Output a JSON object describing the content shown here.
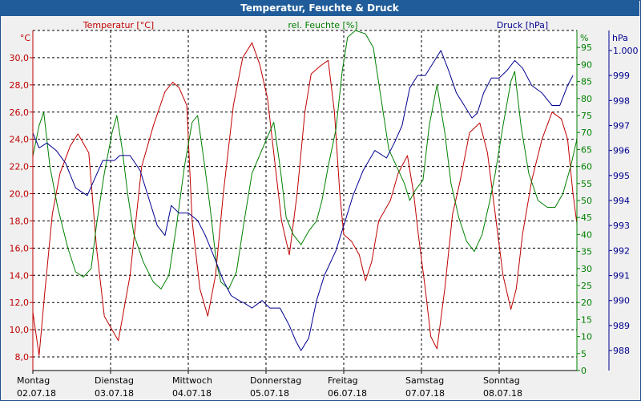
{
  "window": {
    "title": "Temperatur, Feuchte & Druck"
  },
  "chart_data": {
    "type": "line",
    "title": "Temperatur, Feuchte & Druck",
    "grid": true,
    "x_axis": {
      "range": [
        0,
        7
      ],
      "labels": [
        {
          "x": 0,
          "day": "Montag",
          "date": "02.07.18"
        },
        {
          "x": 1,
          "day": "Dienstag",
          "date": "03.07.18"
        },
        {
          "x": 2,
          "day": "Mittwoch",
          "date": "04.07.18"
        },
        {
          "x": 3,
          "day": "Donnerstag",
          "date": "05.07.18"
        },
        {
          "x": 4,
          "day": "Freitag",
          "date": "06.07.18"
        },
        {
          "x": 5,
          "day": "Samstag",
          "date": "07.07.18"
        },
        {
          "x": 6,
          "day": "Sonntag",
          "date": "08.07.18"
        }
      ]
    },
    "axes": {
      "temperature": {
        "label": "Temperatur [°C]",
        "unit": "°C",
        "color": "#c00000",
        "range": [
          7,
          32
        ],
        "ticks": [
          "8,0",
          "10,0",
          "12,0",
          "14,0",
          "16,0",
          "18,0",
          "20,0",
          "22,0",
          "24,0",
          "26,0",
          "28,0",
          "30,0"
        ],
        "tick_values": [
          8,
          10,
          12,
          14,
          16,
          18,
          20,
          22,
          24,
          26,
          28,
          30
        ]
      },
      "humidity": {
        "label": "rel. Feuchte [%]",
        "unit": "%",
        "color": "#008000",
        "range": [
          0,
          100
        ],
        "ticks": [
          "0",
          "5",
          "10",
          "15",
          "20",
          "25",
          "30",
          "35",
          "40",
          "45",
          "50",
          "55",
          "60",
          "65",
          "70",
          "75",
          "80",
          "85",
          "90",
          "95"
        ],
        "tick_values": [
          0,
          5,
          10,
          15,
          20,
          25,
          30,
          35,
          40,
          45,
          50,
          55,
          60,
          65,
          70,
          75,
          80,
          85,
          90,
          95
        ]
      },
      "pressure": {
        "label": "Druck [hPa]",
        "unit": "hPa",
        "color": "#000090",
        "range": [
          987.2,
          1000.8
        ],
        "ticks": [
          "988",
          "989",
          "990",
          "991",
          "992",
          "993",
          "994",
          "995",
          "996",
          "997",
          "998",
          "999",
          "1.000"
        ],
        "tick_values": [
          988,
          989,
          990,
          991,
          992,
          993,
          994,
          995,
          996,
          997,
          998,
          999,
          1000
        ]
      }
    },
    "series": [
      {
        "name": "Temperatur [°C]",
        "axis": "temperature",
        "color": "#c00000",
        "points": [
          [
            0,
            11.3
          ],
          [
            0.08,
            8.1
          ],
          [
            0.15,
            12.5
          ],
          [
            0.25,
            18.5
          ],
          [
            0.35,
            21.5
          ],
          [
            0.48,
            23.5
          ],
          [
            0.58,
            24.4
          ],
          [
            0.72,
            23.0
          ],
          [
            0.82,
            16.0
          ],
          [
            0.92,
            11.0
          ],
          [
            1.1,
            9.2
          ],
          [
            1.25,
            14.0
          ],
          [
            1.4,
            22.0
          ],
          [
            1.55,
            25.0
          ],
          [
            1.7,
            27.5
          ],
          [
            1.8,
            28.2
          ],
          [
            1.88,
            27.8
          ],
          [
            1.98,
            26.5
          ],
          [
            2.05,
            18.0
          ],
          [
            2.15,
            13.0
          ],
          [
            2.25,
            11.0
          ],
          [
            2.35,
            14.0
          ],
          [
            2.45,
            20.0
          ],
          [
            2.58,
            26.5
          ],
          [
            2.7,
            30.0
          ],
          [
            2.82,
            31.1
          ],
          [
            2.92,
            29.5
          ],
          [
            3.02,
            27.0
          ],
          [
            3.12,
            22.0
          ],
          [
            3.2,
            18.0
          ],
          [
            3.3,
            15.5
          ],
          [
            3.4,
            20.0
          ],
          [
            3.5,
            26.0
          ],
          [
            3.58,
            28.8
          ],
          [
            3.7,
            29.4
          ],
          [
            3.8,
            29.8
          ],
          [
            3.88,
            26.0
          ],
          [
            3.95,
            20.0
          ],
          [
            4.0,
            17.0
          ],
          [
            4.1,
            16.5
          ],
          [
            4.2,
            15.5
          ],
          [
            4.28,
            13.6
          ],
          [
            4.36,
            15.0
          ],
          [
            4.45,
            18.0
          ],
          [
            4.6,
            19.5
          ],
          [
            4.7,
            21.5
          ],
          [
            4.82,
            22.8
          ],
          [
            4.9,
            20.0
          ],
          [
            4.96,
            17.0
          ],
          [
            5.05,
            13.0
          ],
          [
            5.12,
            9.5
          ],
          [
            5.2,
            8.6
          ],
          [
            5.3,
            13.0
          ],
          [
            5.4,
            18.5
          ],
          [
            5.5,
            21.0
          ],
          [
            5.62,
            24.5
          ],
          [
            5.75,
            25.2
          ],
          [
            5.85,
            23.0
          ],
          [
            5.95,
            18.5
          ],
          [
            6.05,
            14.0
          ],
          [
            6.15,
            11.5
          ],
          [
            6.22,
            13.0
          ],
          [
            6.3,
            17.0
          ],
          [
            6.42,
            21.0
          ],
          [
            6.55,
            24.0
          ],
          [
            6.68,
            26.0
          ],
          [
            6.8,
            25.5
          ],
          [
            6.88,
            24.0
          ],
          [
            6.95,
            20.0
          ],
          [
            7.0,
            17.8
          ]
        ]
      },
      {
        "name": "rel. Feuchte [%]",
        "axis": "humidity",
        "color": "#008000",
        "points": [
          [
            0,
            63
          ],
          [
            0.08,
            72
          ],
          [
            0.14,
            76
          ],
          [
            0.22,
            60
          ],
          [
            0.32,
            48
          ],
          [
            0.45,
            36
          ],
          [
            0.55,
            29
          ],
          [
            0.65,
            27.5
          ],
          [
            0.75,
            30
          ],
          [
            0.82,
            43
          ],
          [
            0.92,
            58
          ],
          [
            1.02,
            70
          ],
          [
            1.08,
            75
          ],
          [
            1.15,
            65
          ],
          [
            1.22,
            52
          ],
          [
            1.3,
            40
          ],
          [
            1.42,
            32
          ],
          [
            1.55,
            26
          ],
          [
            1.65,
            24
          ],
          [
            1.75,
            28
          ],
          [
            1.85,
            43
          ],
          [
            1.95,
            60
          ],
          [
            2.05,
            73
          ],
          [
            2.12,
            75
          ],
          [
            2.2,
            62
          ],
          [
            2.28,
            48
          ],
          [
            2.36,
            32
          ],
          [
            2.42,
            26
          ],
          [
            2.52,
            24
          ],
          [
            2.62,
            29
          ],
          [
            2.72,
            44
          ],
          [
            2.82,
            58
          ],
          [
            2.95,
            65
          ],
          [
            3.1,
            73
          ],
          [
            3.18,
            60
          ],
          [
            3.26,
            45
          ],
          [
            3.35,
            40
          ],
          [
            3.45,
            37
          ],
          [
            3.55,
            41
          ],
          [
            3.65,
            44
          ],
          [
            3.72,
            50
          ],
          [
            3.8,
            60
          ],
          [
            3.9,
            71
          ],
          [
            3.98,
            88
          ],
          [
            4.05,
            98
          ],
          [
            4.15,
            100
          ],
          [
            4.28,
            99
          ],
          [
            4.38,
            95
          ],
          [
            4.48,
            80
          ],
          [
            4.58,
            65
          ],
          [
            4.68,
            60
          ],
          [
            4.78,
            55
          ],
          [
            4.85,
            50
          ],
          [
            4.92,
            53
          ],
          [
            5.02,
            56
          ],
          [
            5.1,
            72
          ],
          [
            5.2,
            84
          ],
          [
            5.3,
            70
          ],
          [
            5.38,
            55
          ],
          [
            5.48,
            45
          ],
          [
            5.58,
            38
          ],
          [
            5.68,
            35
          ],
          [
            5.78,
            40
          ],
          [
            5.88,
            50
          ],
          [
            5.95,
            58
          ],
          [
            6.05,
            72
          ],
          [
            6.15,
            85
          ],
          [
            6.2,
            88
          ],
          [
            6.28,
            72
          ],
          [
            6.38,
            58
          ],
          [
            6.5,
            50
          ],
          [
            6.62,
            48
          ],
          [
            6.72,
            48
          ],
          [
            6.82,
            52
          ],
          [
            6.92,
            60
          ],
          [
            7.0,
            68
          ]
        ]
      },
      {
        "name": "Druck [hPa]",
        "axis": "pressure",
        "color": "#000090",
        "points": [
          [
            0,
            996.7
          ],
          [
            0.08,
            996.1
          ],
          [
            0.18,
            996.3
          ],
          [
            0.3,
            996.0
          ],
          [
            0.42,
            995.5
          ],
          [
            0.55,
            994.5
          ],
          [
            0.7,
            994.2
          ],
          [
            0.8,
            994.9
          ],
          [
            0.9,
            995.6
          ],
          [
            1.05,
            995.6
          ],
          [
            1.12,
            995.8
          ],
          [
            1.25,
            995.8
          ],
          [
            1.38,
            995.2
          ],
          [
            1.5,
            994.0
          ],
          [
            1.6,
            993.0
          ],
          [
            1.7,
            992.6
          ],
          [
            1.78,
            993.8
          ],
          [
            1.88,
            993.5
          ],
          [
            2.0,
            993.5
          ],
          [
            2.12,
            993.2
          ],
          [
            2.22,
            992.6
          ],
          [
            2.35,
            991.6
          ],
          [
            2.45,
            990.8
          ],
          [
            2.55,
            990.2
          ],
          [
            2.65,
            990.0
          ],
          [
            2.72,
            989.9
          ],
          [
            2.82,
            989.7
          ],
          [
            2.95,
            990.0
          ],
          [
            3.05,
            989.7
          ],
          [
            3.18,
            989.7
          ],
          [
            3.3,
            989.0
          ],
          [
            3.38,
            988.4
          ],
          [
            3.45,
            988.0
          ],
          [
            3.55,
            988.5
          ],
          [
            3.65,
            990.0
          ],
          [
            3.75,
            991.0
          ],
          [
            3.9,
            992.0
          ],
          [
            4.0,
            993.0
          ],
          [
            4.12,
            994.2
          ],
          [
            4.25,
            995.2
          ],
          [
            4.4,
            996.0
          ],
          [
            4.55,
            995.7
          ],
          [
            4.65,
            996.3
          ],
          [
            4.75,
            997.0
          ],
          [
            4.85,
            998.5
          ],
          [
            4.95,
            999.0
          ],
          [
            5.05,
            999.0
          ],
          [
            5.15,
            999.5
          ],
          [
            5.25,
            1000.0
          ],
          [
            5.35,
            999.2
          ],
          [
            5.45,
            998.3
          ],
          [
            5.55,
            997.8
          ],
          [
            5.65,
            997.3
          ],
          [
            5.72,
            997.5
          ],
          [
            5.8,
            998.3
          ],
          [
            5.9,
            998.9
          ],
          [
            6.0,
            998.9
          ],
          [
            6.1,
            999.2
          ],
          [
            6.2,
            999.6
          ],
          [
            6.3,
            999.3
          ],
          [
            6.42,
            998.6
          ],
          [
            6.55,
            998.3
          ],
          [
            6.68,
            997.8
          ],
          [
            6.78,
            997.8
          ],
          [
            6.88,
            998.6
          ],
          [
            6.95,
            999.0
          ]
        ]
      }
    ]
  }
}
